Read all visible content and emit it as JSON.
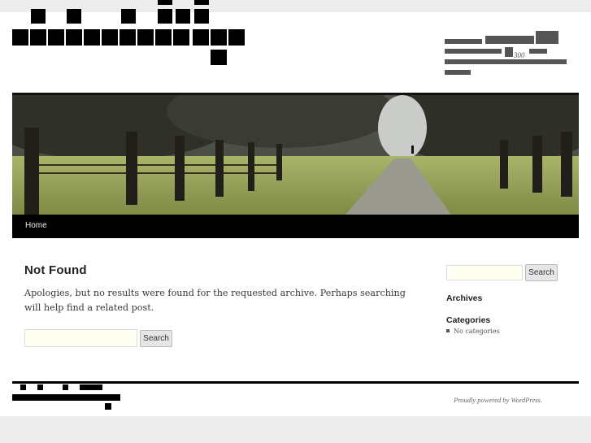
{
  "site": {
    "title_glyph_color": "#000000",
    "description_number": "300"
  },
  "nav": {
    "home_label": "Home"
  },
  "content": {
    "heading": "Not Found",
    "message": "Apologies, but no results were found for the requested archive. Perhaps searching will help find a related post.",
    "search_button": "Search",
    "search_value": ""
  },
  "sidebar": {
    "search_button": "Search",
    "search_value": "",
    "archives_title": "Archives",
    "categories_title": "Categories",
    "categories_empty": "No categories"
  },
  "footer": {
    "credit": "Proudly powered by WordPress."
  },
  "colors": {
    "nav_bg": "#000000",
    "input_bg": "#fffff2",
    "page_bg": "#ededed"
  }
}
